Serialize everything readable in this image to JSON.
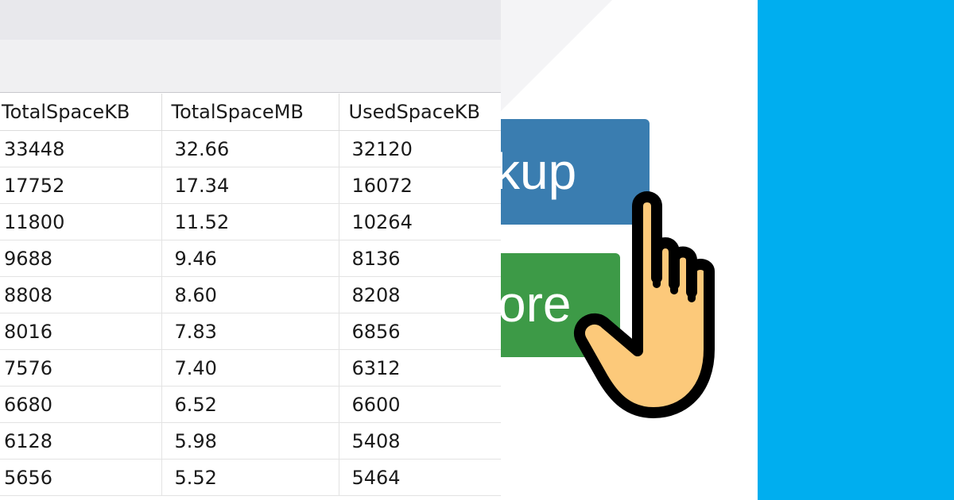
{
  "grid": {
    "columns": [
      "TotalSpaceKB",
      "TotalSpaceMB",
      "UsedSpaceKB"
    ],
    "rows": [
      [
        "33448",
        "32.66",
        "32120"
      ],
      [
        "17752",
        "17.34",
        "16072"
      ],
      [
        "11800",
        "11.52",
        "10264"
      ],
      [
        "9688",
        "9.46",
        "8136"
      ],
      [
        "8808",
        "8.60",
        "8208"
      ],
      [
        "8016",
        "7.83",
        "6856"
      ],
      [
        "7576",
        "7.40",
        "6312"
      ],
      [
        "6680",
        "6.52",
        "6600"
      ],
      [
        "6128",
        "5.98",
        "5408"
      ],
      [
        "5656",
        "5.52",
        "5464"
      ]
    ]
  },
  "promo": {
    "backup_label": "kup",
    "restore_label": "ore"
  },
  "colors": {
    "backup_button": "#3a7db0",
    "restore_button": "#3d9a47",
    "hand_fill": "#fcc97a",
    "side_panel": "#00aeef"
  },
  "icons": {
    "pointer": "pointing-hand-icon"
  }
}
